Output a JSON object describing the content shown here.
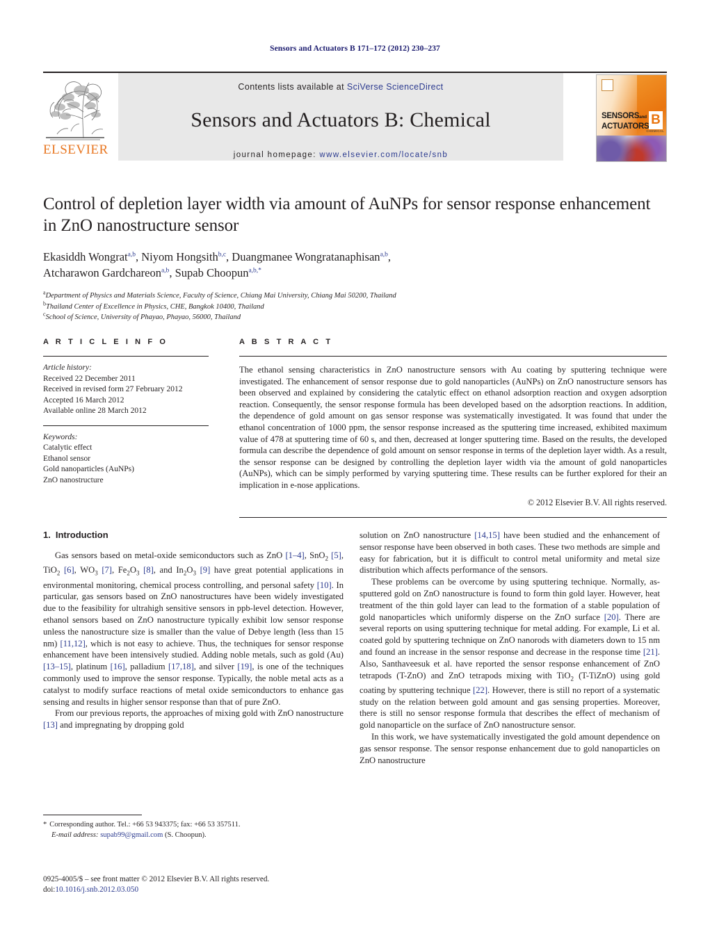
{
  "running_head": "Sensors and Actuators B 171–172 (2012) 230–237",
  "masthead": {
    "contents_prefix": "Contents lists available at ",
    "contents_link": "SciVerse ScienceDirect",
    "journal_title": "Sensors and Actuators B: Chemical",
    "homepage_label": "journal homepage:",
    "homepage_url": "www.elsevier.com/locate/snb",
    "publisher_wordmark": "ELSEVIER",
    "cover": {
      "line1": "SENSORS",
      "line1_small": "and",
      "line2": "ACTUATORS",
      "letter": "B",
      "chem": "CHEMICAL"
    }
  },
  "article": {
    "title": "Control of depletion layer width via amount of AuNPs for sensor response enhancement in ZnO nanostructure sensor",
    "authors": [
      {
        "name": "Ekasiddh Wongrat",
        "sup": "a,b",
        "sep": ", "
      },
      {
        "name": "Niyom Hongsith",
        "sup": "b,c",
        "sep": ", "
      },
      {
        "name": "Duangmanee Wongratanaphisan",
        "sup": "a,b",
        "sep": ","
      },
      {
        "name": "Atcharawon Gardchareon",
        "sup": "a,b",
        "sep": ", "
      },
      {
        "name": "Supab Choopun",
        "sup": "a,b,*",
        "sep": ""
      }
    ],
    "affiliations": [
      {
        "mark": "a",
        "text": "Department of Physics and Materials Science, Faculty of Science, Chiang Mai University, Chiang Mai 50200, Thailand"
      },
      {
        "mark": "b",
        "text": "Thailand Center of Excellence in Physics, CHE, Bangkok 10400, Thailand"
      },
      {
        "mark": "c",
        "text": "School of Science, University of Phayao, Phayao, 56000, Thailand"
      }
    ]
  },
  "article_info": {
    "heading": "A R T I C L E   I N F O",
    "history_label": "Article history:",
    "history": [
      "Received 22 December 2011",
      "Received in revised form 27 February 2012",
      "Accepted 16 March 2012",
      "Available online 28 March 2012"
    ],
    "keywords_label": "Keywords:",
    "keywords": [
      "Catalytic effect",
      "Ethanol sensor",
      "Gold nanoparticles (AuNPs)",
      "ZnO nanostructure"
    ]
  },
  "abstract": {
    "heading": "A B S T R A C T",
    "text": "The ethanol sensing characteristics in ZnO nanostructure sensors with Au coating by sputtering technique were investigated. The enhancement of sensor response due to gold nanoparticles (AuNPs) on ZnO nanostructure sensors has been observed and explained by considering the catalytic effect on ethanol adsorption reaction and oxygen adsorption reaction. Consequently, the sensor response formula has been developed based on the adsorption reactions. In addition, the dependence of gold amount on gas sensor response was systematically investigated. It was found that under the ethanol concentration of 1000 ppm, the sensor response increased as the sputtering time increased, exhibited maximum value of 478 at sputtering time of 60 s, and then, decreased at longer sputtering time. Based on the results, the developed formula can describe the dependence of gold amount on sensor response in terms of the depletion layer width. As a result, the sensor response can be designed by controlling the depletion layer width via the amount of gold nanoparticles (AuNPs), which can be simply performed by varying sputtering time. These results can be further explored for their an implication in e-nose applications.",
    "copyright": "© 2012 Elsevier B.V. All rights reserved."
  },
  "introduction": {
    "heading_number": "1.",
    "heading_text": "Introduction",
    "left_paragraphs": [
      "Gas sensors based on metal-oxide semiconductors such as ZnO [1–4], SnO2 [5], TiO2 [6], WO3 [7], Fe2O3 [8], and In2O3 [9] have great potential applications in environmental monitoring, chemical process controlling, and personal safety [10]. In particular, gas sensors based on ZnO nanostructures have been widely investigated due to the feasibility for ultrahigh sensitive sensors in ppb-level detection. However, ethanol sensors based on ZnO nanostructure typically exhibit low sensor response unless the nanostructure size is smaller than the value of Debye length (less than 15 nm) [11,12], which is not easy to achieve. Thus, the techniques for sensor response enhancement have been intensively studied. Adding noble metals, such as gold (Au) [13–15], platinum [16], palladium [17,18], and silver [19], is one of the techniques commonly used to improve the sensor response. Typically, the noble metal acts as a catalyst to modify surface reactions of metal oxide semiconductors to enhance gas sensing and results in higher sensor response than that of pure ZnO.",
      "From our previous reports, the approaches of mixing gold with ZnO nanostructure [13] and impregnating by dropping gold"
    ],
    "right_paragraphs": [
      "solution on ZnO nanostructure [14,15] have been studied and the enhancement of sensor response have been observed in both cases. These two methods are simple and easy for fabrication, but it is difficult to control metal uniformity and metal size distribution which affects performance of the sensors.",
      "These problems can be overcome by using sputtering technique. Normally, as-sputtered gold on ZnO nanostructure is found to form thin gold layer. However, heat treatment of the thin gold layer can lead to the formation of a stable population of gold nanoparticles which uniformly disperse on the ZnO surface [20]. There are several reports on using sputtering technique for metal adding. For example, Li et al. coated gold by sputtering technique on ZnO nanorods with diameters down to 15 nm and found an increase in the sensor response and decrease in the response time [21]. Also, Santhaveesuk et al. have reported the sensor response enhancement of ZnO tetrapods (T-ZnO) and ZnO tetrapods mixing with TiO2 (T-TiZnO) using gold coating by sputtering technique [22]. However, there is still no report of a systematic study on the relation between gold amount and gas sensing properties. Moreover, there is still no sensor response formula that describes the effect of mechanism of gold nanoparticle on the surface of ZnO nanostructure sensor.",
      "In this work, we have systematically investigated the gold amount dependence on gas sensor response. The sensor response enhancement due to gold nanoparticles on ZnO nanostructure"
    ]
  },
  "footnote": {
    "star": "*",
    "corresponding": "Corresponding author. Tel.: +66 53 943375; fax: +66 53 357511.",
    "email_label": "E-mail address:",
    "email": "supab99@gmail.com",
    "email_suffix": "(S. Choopun)."
  },
  "footer": {
    "issn_line": "0925-4005/$ – see front matter © 2012 Elsevier B.V. All rights reserved.",
    "doi_label": "doi:",
    "doi_value": "10.1016/j.snb.2012.03.050"
  }
}
